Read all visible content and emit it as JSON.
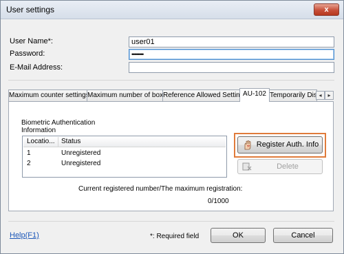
{
  "window": {
    "title": "User settings",
    "close_glyph": "x"
  },
  "form": {
    "user_name_label": "User Name*:",
    "user_name_value": "user01",
    "password_label": "Password:",
    "password_value": "••••••••",
    "email_label": "E-Mail Address:",
    "email_value": ""
  },
  "tabs": [
    {
      "label": "Maximum counter settings"
    },
    {
      "label": "Maximum number of boxes"
    },
    {
      "label": "Reference Allowed Setting"
    },
    {
      "label": "AU-102"
    },
    {
      "label": "Temporarily Disa"
    }
  ],
  "tab_scroll": {
    "left": "◂",
    "right": "▸"
  },
  "biometric": {
    "title_line1": "Biometric Authentication",
    "title_line2": "Information",
    "columns": [
      "Locatio...",
      "Status"
    ],
    "rows": [
      {
        "location": "1",
        "status": "Unregistered"
      },
      {
        "location": "2",
        "status": "Unregistered"
      }
    ],
    "register_label": "Register Auth. Info",
    "delete_label": "Delete",
    "current_label": "Current registered number/The maximum registration:",
    "current_value": "0/1000"
  },
  "footer": {
    "help_label": "Help(F1)",
    "required_note": "*: Required field",
    "ok_label": "OK",
    "cancel_label": "Cancel"
  },
  "colors": {
    "highlight": "#e07b3a",
    "link": "#1a56b8"
  }
}
